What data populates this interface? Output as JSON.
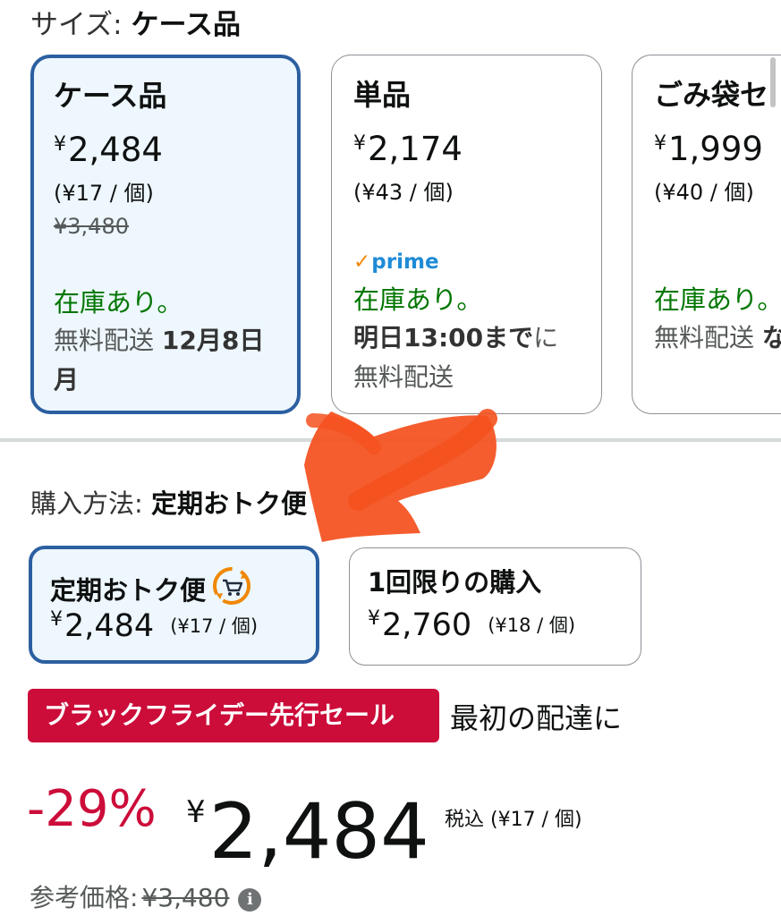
{
  "size_section": {
    "label": "サイズ:",
    "selected": "ケース品",
    "options": [
      {
        "name": "ケース品",
        "price_yen": "¥",
        "price": "2,484",
        "unit_price": "(¥17 / 個)",
        "list_price": "¥3,480",
        "stock": "在庫あり。",
        "delivery_prefix": "無料配送",
        "delivery_date": "12月8日 月"
      },
      {
        "name": "単品",
        "price_yen": "¥",
        "price": "2,174",
        "unit_price": "(¥43 / 個)",
        "prime": "prime",
        "stock": "在庫あり。",
        "delivery_strong": "明日13:00まで",
        "delivery_suffix": "に",
        "delivery_free": "無料配送"
      },
      {
        "name": "ごみ袋セ",
        "price_yen": "¥",
        "price": "1,999",
        "unit_price": "(¥40 / 個)",
        "stock": "在庫あり。",
        "delivery_prefix": "無料配送",
        "delivery_date": "な"
      }
    ]
  },
  "purchase_section": {
    "label": "購入方法:",
    "selected": "定期おトク便",
    "options": [
      {
        "name": "定期おトク便",
        "price_yen": "¥",
        "price": "2,484",
        "unit_price": "(¥17 / 個)",
        "icon": "subscribe-cart-icon"
      },
      {
        "name": "1回限りの購入",
        "price_yen": "¥",
        "price": "2,760",
        "unit_price": "(¥18 / 個)"
      }
    ]
  },
  "deal": {
    "badge": "ブラックフライデー先行セール",
    "suffix": "最初の配達に"
  },
  "price_block": {
    "discount": "-29%",
    "yen": "¥",
    "price": "2,484",
    "tax_note": "税込 (¥17 / 個)",
    "ref_label": "参考価格:",
    "ref_value": "¥3,480",
    "info_icon": "i"
  },
  "colors": {
    "selected_border": "#2b5fa0",
    "selected_bg": "#edf7fd",
    "stock_green": "#007600",
    "deal_red": "#cc0c39",
    "prime_blue": "#1f8bd6",
    "annotation_arrow": "#f4511e"
  }
}
